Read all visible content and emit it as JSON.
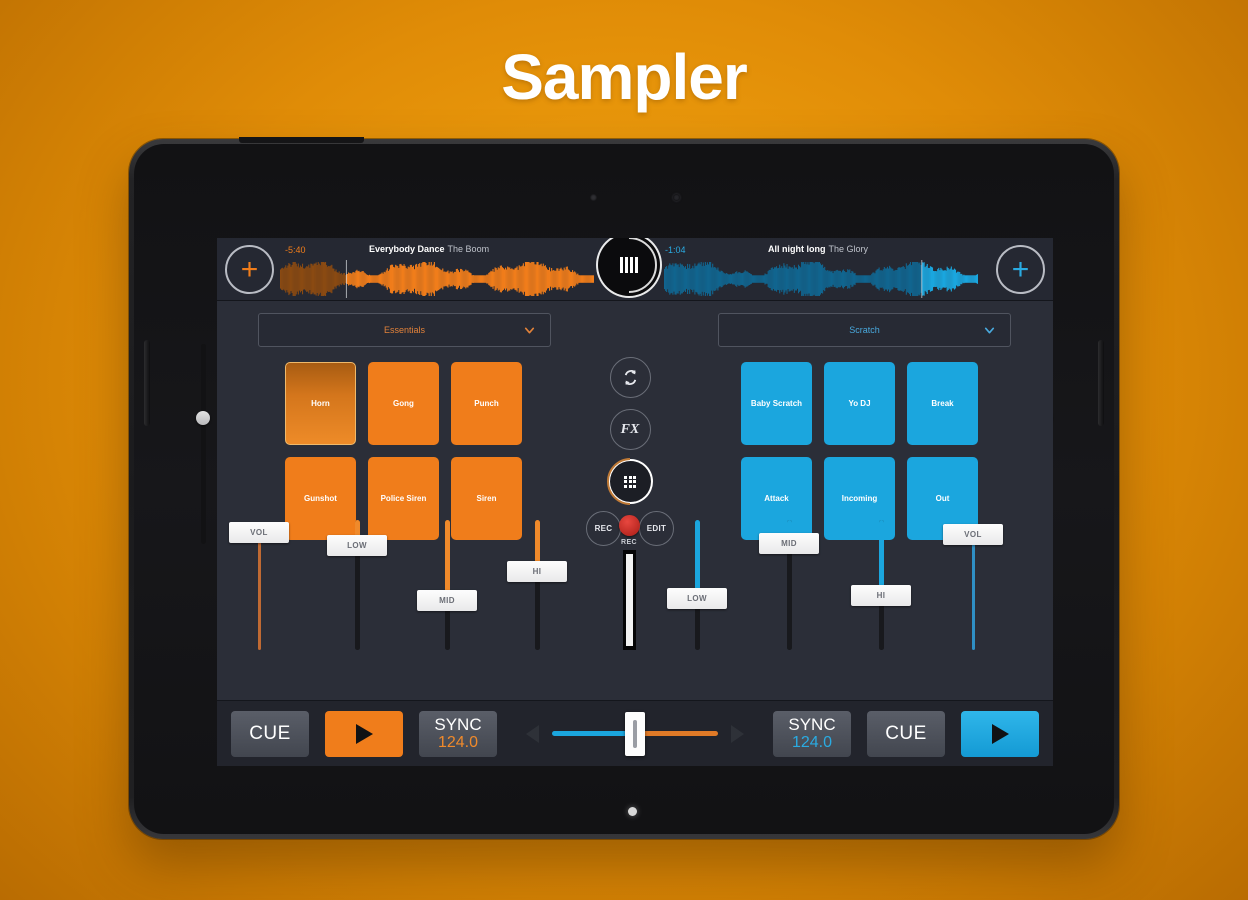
{
  "page": {
    "title": "Sampler"
  },
  "decks": {
    "left": {
      "add_label": "+",
      "time_remaining": "-5:40",
      "track_title": "Everybody Dance",
      "track_artist": "The Boom",
      "accent": "#f07d1b",
      "progress_pct": 21
    },
    "right": {
      "add_label": "+",
      "time_remaining": "-1:04",
      "track_title": "All night long",
      "track_artist": "The Glory",
      "accent": "#1ba6de",
      "progress_pct": 82
    }
  },
  "selectors": {
    "left": {
      "value": "Essentials",
      "icon": "chevron-down-icon",
      "color": "#e2823a"
    },
    "right": {
      "value": "Scratch",
      "icon": "chevron-down-icon",
      "color": "#49a9dd"
    }
  },
  "pads": {
    "left": [
      {
        "label": "Horn",
        "active": true
      },
      {
        "label": "Gong",
        "active": false
      },
      {
        "label": "Punch",
        "active": false
      },
      {
        "label": "Gunshot",
        "active": false
      },
      {
        "label": "Police Siren",
        "active": false
      },
      {
        "label": "Siren",
        "active": false
      }
    ],
    "right": [
      {
        "label": "Baby Scratch",
        "active": false
      },
      {
        "label": "Yo DJ",
        "active": false
      },
      {
        "label": "Break",
        "active": false
      },
      {
        "label": "Attack",
        "active": false
      },
      {
        "label": "Incoming",
        "active": false
      },
      {
        "label": "Out",
        "active": false
      }
    ]
  },
  "center": {
    "loop_icon": "loop-arrows-icon",
    "fx_label": "FX",
    "grid_icon": "grid-icon",
    "rec_label": "REC",
    "edit_label": "EDIT"
  },
  "recorder": {
    "label": "REC",
    "dot_color": "#c8312a",
    "meter_level_pct": 100
  },
  "mixer": {
    "left": [
      {
        "label": "VOL",
        "value_pct": 98,
        "accent": "#c06a33"
      },
      {
        "label": "LOW",
        "value_pct": 86,
        "accent": "#f08a2b"
      },
      {
        "label": "MID",
        "value_pct": 36,
        "accent": "#f08a2b"
      },
      {
        "label": "HI",
        "value_pct": 62,
        "accent": "#f08a2b"
      }
    ],
    "right": [
      {
        "label": "LOW",
        "value_pct": 38,
        "accent": "#1ba6de"
      },
      {
        "label": "MID",
        "value_pct": 88,
        "accent": "#1ba6de"
      },
      {
        "label": "HI",
        "value_pct": 40,
        "accent": "#1ba6de"
      },
      {
        "label": "VOL",
        "value_pct": 96,
        "accent": "#2f8fc4"
      }
    ]
  },
  "transport": {
    "left": {
      "cue_label": "CUE",
      "play_icon": "play-icon",
      "sync_label": "SYNC",
      "bpm": "124.0"
    },
    "right": {
      "sync_label": "SYNC",
      "bpm": "124.0",
      "cue_label": "CUE",
      "play_icon": "play-icon"
    },
    "crossfader": {
      "left_arrow_icon": "arrow-left-icon",
      "right_arrow_icon": "arrow-right-icon",
      "position_pct": 50,
      "left_color": "#1ba6de",
      "right_color": "#e07a27"
    }
  },
  "hardware": {
    "left_slider_pct": 36,
    "right_slider_pct": 36
  }
}
